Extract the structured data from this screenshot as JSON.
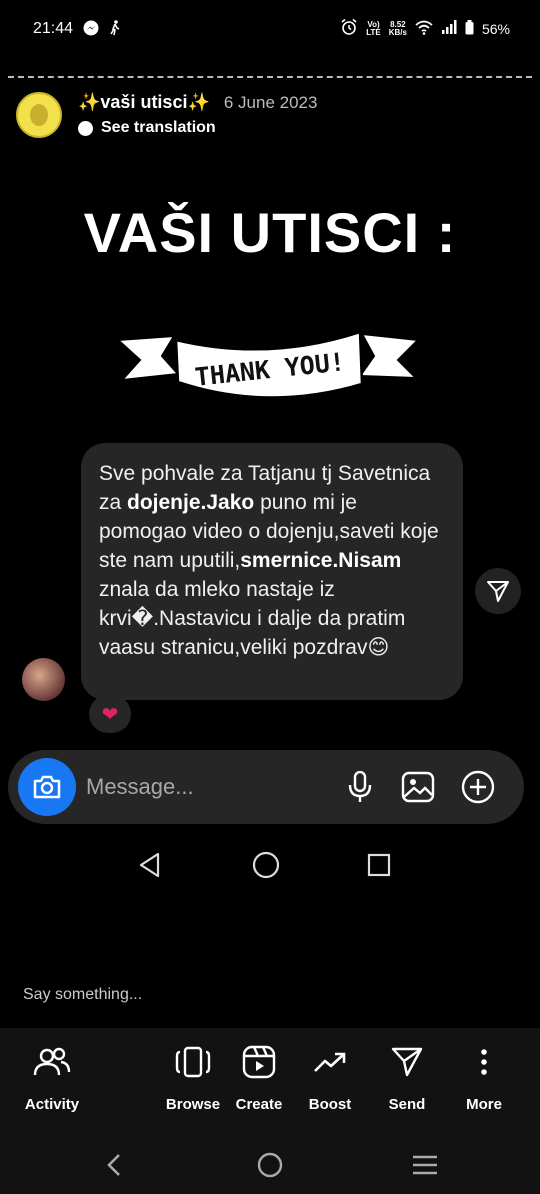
{
  "status_bar": {
    "time": "21:44",
    "network_top": "Vo)",
    "network_bottom": "LTE",
    "speed_top": "8.52",
    "speed_bottom": "KB/s",
    "battery": "56%"
  },
  "story": {
    "account_name": "✨vaši utisci✨",
    "date": "6 June 2023",
    "see_translation": "See translation",
    "title": "VAŠI UTISCI :",
    "ribbon_text": "THANK YOU!"
  },
  "chat": {
    "segments": [
      "Sve pohvale za Tatjanu tj Savetnica za ",
      "dojenje.Jako",
      " puno mi je pomogao video o dojenju,saveti koje ste nam uputili,",
      "smernice.Nisam",
      " znala da mleko nastaje iz krvi",
      "�",
      ".Nastavicu i dalje da pratim vaasu stranicu,veliki pozdrav😊"
    ],
    "reaction": "❤"
  },
  "message_bar": {
    "placeholder": "Message..."
  },
  "say_something": "Say something...",
  "actions": [
    {
      "label": "Activity",
      "icon": "people-icon"
    },
    {
      "label": "Browse",
      "icon": "browse-icon"
    },
    {
      "label": "Create",
      "icon": "reels-icon"
    },
    {
      "label": "Boost",
      "icon": "trending-icon"
    },
    {
      "label": "Send",
      "icon": "send-icon"
    },
    {
      "label": "More",
      "icon": "more-icon"
    }
  ],
  "colors": {
    "background": "#000000",
    "bubble": "#262626",
    "accent": "#1877f2",
    "heart": "#e0245e"
  }
}
